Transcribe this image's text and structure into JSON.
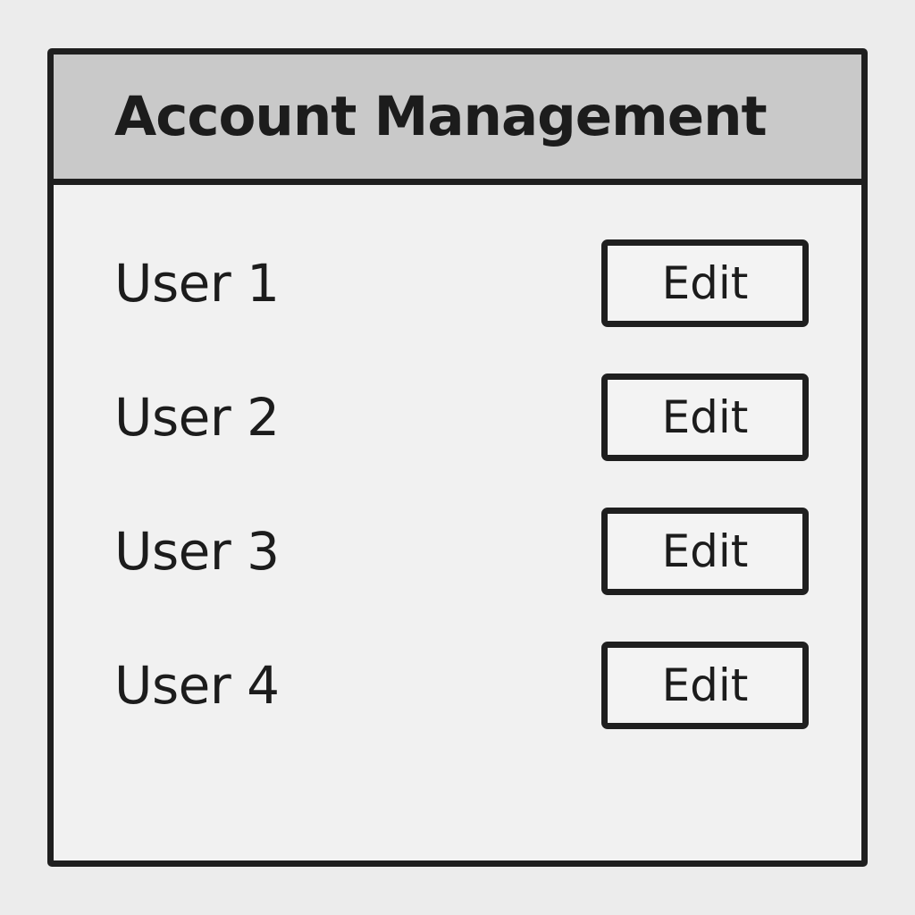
{
  "panel": {
    "title": "Account Management"
  },
  "users": [
    {
      "name": "User 1",
      "action_label": "Edit"
    },
    {
      "name": "User 2",
      "action_label": "Edit"
    },
    {
      "name": "User 3",
      "action_label": "Edit"
    },
    {
      "name": "User 4",
      "action_label": "Edit"
    }
  ],
  "colors": {
    "page_background": "#ececec",
    "panel_background": "#f1f1f1",
    "header_background": "#c9c9c9",
    "border": "#1f1f1f",
    "text": "#1c1c1c"
  }
}
